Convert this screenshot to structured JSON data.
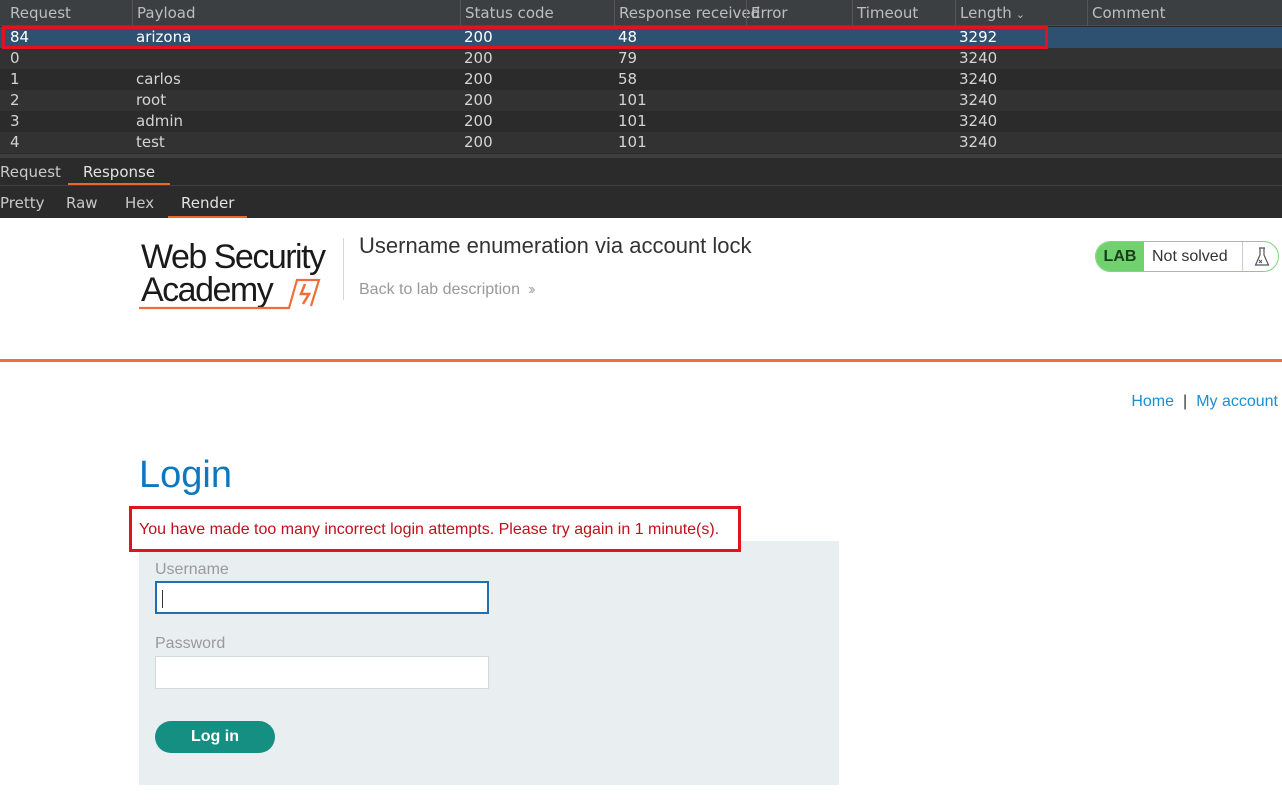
{
  "results_table": {
    "columns": [
      "Request",
      "Payload",
      "Status code",
      "Response received",
      "Error",
      "Timeout",
      "Length",
      "Comment"
    ],
    "sorted_column": "Length",
    "rows": [
      {
        "request": "84",
        "payload": "arizona",
        "status": "200",
        "response_received": "48",
        "error": "",
        "timeout": "",
        "length": "3292",
        "comment": "",
        "selected": true
      },
      {
        "request": "0",
        "payload": "",
        "status": "200",
        "response_received": "79",
        "error": "",
        "timeout": "",
        "length": "3240",
        "comment": ""
      },
      {
        "request": "1",
        "payload": "carlos",
        "status": "200",
        "response_received": "58",
        "error": "",
        "timeout": "",
        "length": "3240",
        "comment": ""
      },
      {
        "request": "2",
        "payload": "root",
        "status": "200",
        "response_received": "101",
        "error": "",
        "timeout": "",
        "length": "3240",
        "comment": ""
      },
      {
        "request": "3",
        "payload": "admin",
        "status": "200",
        "response_received": "101",
        "error": "",
        "timeout": "",
        "length": "3240",
        "comment": ""
      },
      {
        "request": "4",
        "payload": "test",
        "status": "200",
        "response_received": "101",
        "error": "",
        "timeout": "",
        "length": "3240",
        "comment": ""
      }
    ]
  },
  "message_tabs": {
    "items": [
      "Request",
      "Response"
    ],
    "active": "Response"
  },
  "view_tabs": {
    "items": [
      "Pretty",
      "Raw",
      "Hex",
      "Render"
    ],
    "active": "Render"
  },
  "rendered_page": {
    "logo_text_line1": "Web Security",
    "logo_text_line2": "Academy",
    "lab_title": "Username enumeration via account lock",
    "back_link": "Back to lab description",
    "lab_badge": {
      "label": "LAB",
      "status": "Not solved"
    },
    "nav": {
      "home": "Home",
      "separator": "|",
      "account": "My account"
    },
    "heading": "Login",
    "error_message": "You have made too many incorrect login attempts. Please try again in 1 minute(s).",
    "username_label": "Username",
    "username_value": "",
    "password_label": "Password",
    "password_value": "",
    "login_button": "Log in"
  },
  "colors": {
    "accent_orange": "#ee6f3a",
    "login_blue": "#0d78bd",
    "button_teal": "#168f83",
    "error_red": "#c0101a",
    "selected_row": "#2f5171",
    "highlight_box": "#e0141e"
  }
}
